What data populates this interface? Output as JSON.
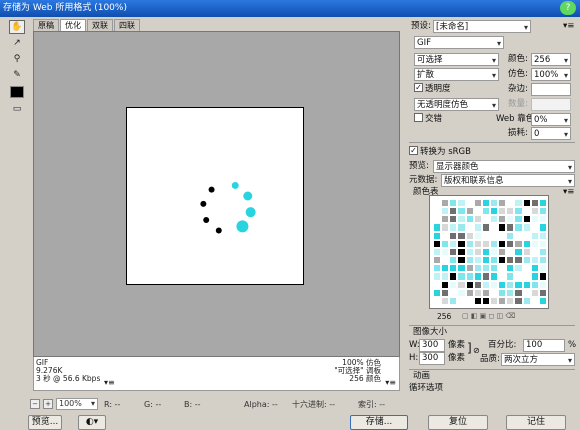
{
  "window": {
    "title": "存储为 Web 所用格式 (100%)"
  },
  "tabs": [
    "原稿",
    "优化",
    "双联",
    "四联"
  ],
  "active_tab": 1,
  "tools": [
    "hand-icon",
    "slice-select-icon",
    "zoom-icon",
    "eyedropper-icon"
  ],
  "info": {
    "format": "GIF",
    "size": "9.276K",
    "time": "3 秒 @ 56.6 Kbps",
    "quality": "100% 仿色",
    "palette": "\"可选择\" 调板",
    "colors": "256 颜色"
  },
  "status": {
    "zoom": "100%",
    "r": "R: --",
    "g": "G: --",
    "b": "B: --",
    "alpha": "Alpha: --",
    "hex": "十六进制: --",
    "index": "索引: --"
  },
  "buttons": {
    "preview": "预览...",
    "save": "存储...",
    "reset": "复位",
    "remember": "记住"
  },
  "panel": {
    "preset_label": "预设:",
    "preset_value": "[未命名]",
    "format_value": "GIF",
    "reduction_value": "可选择",
    "dither_algo_value": "扩散",
    "transparency_label": "透明度",
    "transparency_checked": true,
    "matte_algo_value": "无透明度仿色",
    "interlaced_label": "交错",
    "interlaced_checked": false,
    "colors_label": "颜色:",
    "colors_value": "256",
    "dither_label": "仿色:",
    "dither_value": "100%",
    "matte_label": "杂边:",
    "amount_label": "数量:",
    "websnap_label": "Web 靠色:",
    "websnap_value": "0%",
    "lossy_label": "损耗:",
    "lossy_value": "0",
    "convert_srgb_label": "转换为 sRGB",
    "convert_srgb_checked": true,
    "preview_label": "预览:",
    "preview_value": "显示器颜色",
    "metadata_label": "元数据:",
    "metadata_value": "版权和联系信息",
    "color_table_label": "颜色表",
    "color_count": "256",
    "image_size_label": "图像大小",
    "w_label": "W:",
    "w_value": "300",
    "h_label": "H:",
    "h_value": "300",
    "px_label": "像素",
    "percent_label": "百分比:",
    "percent_value": "100",
    "percent_unit": "%",
    "quality_label": "品质:",
    "quality_value": "两次立方",
    "animation_label": "动画",
    "loop_label": "循环选项"
  },
  "colors": {
    "accent": "#2ad3e0",
    "canvas_bg": "#a8a8a8",
    "title_bar": "#1f5fc0"
  },
  "spinner_dots": [
    {
      "color": "#2ad3e0"
    },
    {
      "color": "#2ad3e0"
    },
    {
      "color": "#2ad3e0"
    },
    {
      "color": "#2ad3e0"
    },
    {
      "color": "#000000"
    },
    {
      "color": "#000000"
    },
    {
      "color": "#000000"
    },
    {
      "color": "#000000"
    }
  ]
}
